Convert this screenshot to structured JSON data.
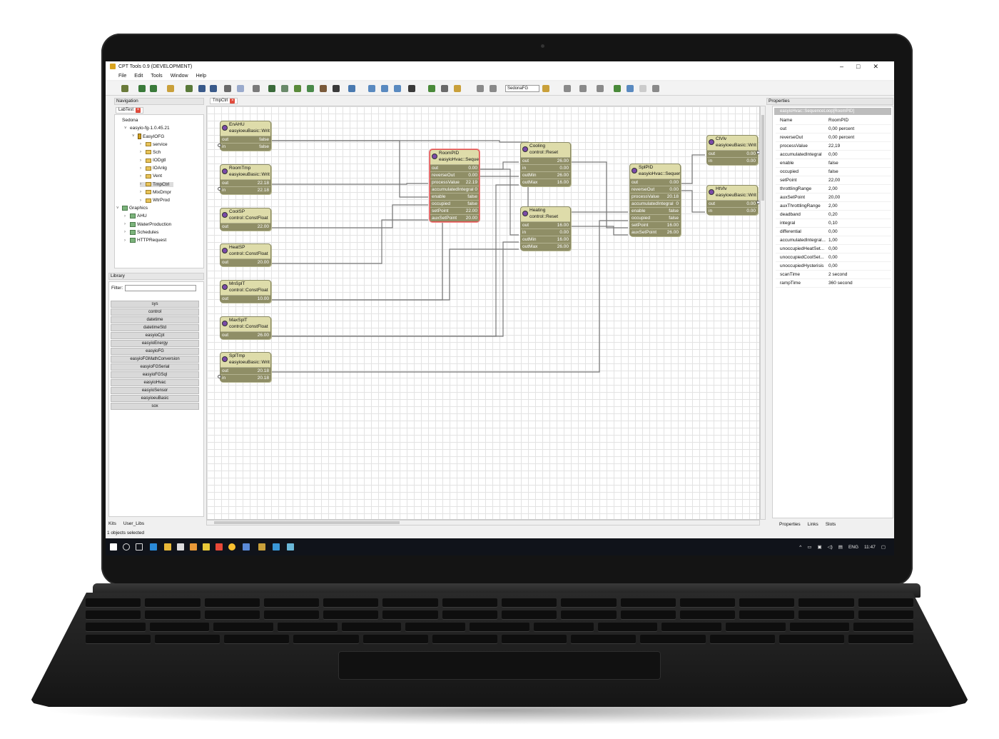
{
  "window": {
    "title": "CPT Tools 0.9 (DEVELOPMENT)",
    "controls": [
      "–",
      "□",
      "✕"
    ]
  },
  "menu": [
    "File",
    "Edit",
    "Tools",
    "Window",
    "Help"
  ],
  "toolbar": {
    "platform_select": "SedonaFG"
  },
  "navigation": {
    "title": "Navigation",
    "tab": "LabTest",
    "tree": [
      {
        "label": "Sedona",
        "depth": 0,
        "icon": "none",
        "arrow": ""
      },
      {
        "label": "easyio-fg-1.0.45.21",
        "depth": 1,
        "icon": "none",
        "arrow": "˅"
      },
      {
        "label": "EasyIOFG",
        "depth": 2,
        "icon": "device",
        "arrow": "˅"
      },
      {
        "label": "service",
        "depth": 3,
        "icon": "folder",
        "arrow": "›"
      },
      {
        "label": "Sch",
        "depth": 3,
        "icon": "folder",
        "arrow": "›"
      },
      {
        "label": "IODgtl",
        "depth": 3,
        "icon": "folder",
        "arrow": "›"
      },
      {
        "label": "IOAnlg",
        "depth": 3,
        "icon": "folder",
        "arrow": "›"
      },
      {
        "label": "Vent",
        "depth": 3,
        "icon": "folder",
        "arrow": "›"
      },
      {
        "label": "TmpCtrl",
        "depth": 3,
        "icon": "folder",
        "arrow": "›",
        "selected": true
      },
      {
        "label": "MixDmpr",
        "depth": 3,
        "icon": "folder",
        "arrow": "›"
      },
      {
        "label": "WtrProd",
        "depth": 3,
        "icon": "folder",
        "arrow": "›"
      },
      {
        "label": "Graphics",
        "depth": 0,
        "icon": "graphics",
        "arrow": "˅"
      },
      {
        "label": "AHU",
        "depth": 1,
        "icon": "graphics",
        "arrow": "›"
      },
      {
        "label": "WaterProduction",
        "depth": 1,
        "icon": "graphics",
        "arrow": "›"
      },
      {
        "label": "Schedules",
        "depth": 1,
        "icon": "graphics",
        "arrow": "›"
      },
      {
        "label": "HTTPRequest",
        "depth": 1,
        "icon": "graphics",
        "arrow": "›"
      }
    ]
  },
  "library": {
    "title": "Library",
    "filter_label": "Filter:",
    "items": [
      "sys",
      "control",
      "datetime",
      "datetimeStd",
      "easyioCpt",
      "easyioEnergy",
      "easyioFG",
      "easyioFGMathConversion",
      "easyioFGSerial",
      "easyioFGSql",
      "easyioHvac",
      "easyioSensor",
      "easyioeuBasic",
      "sox"
    ],
    "bottom_tabs": [
      "Kits",
      "User_Libs"
    ]
  },
  "wiresheet": {
    "tab": "TmpCtrl",
    "blocks": [
      {
        "id": "enahu",
        "name": "EnAHU",
        "type": "easyioeuBasic::Writ",
        "slots": [
          [
            "out",
            "false"
          ],
          [
            "in",
            "false"
          ]
        ]
      },
      {
        "id": "roomtmp",
        "name": "RoomTmp",
        "type": "easyioeuBasic::Writ",
        "slots": [
          [
            "out",
            "22.18"
          ],
          [
            "in",
            "22.18"
          ]
        ]
      },
      {
        "id": "coolsp",
        "name": "CoolSP",
        "type": "control::ConstFloat",
        "slots": [
          [
            "out",
            "22.00"
          ]
        ]
      },
      {
        "id": "heatsp",
        "name": "HeatSP",
        "type": "control::ConstFloat",
        "slots": [
          [
            "out",
            "20.00"
          ]
        ]
      },
      {
        "id": "mnsplt",
        "name": "MnSplT",
        "type": "control::ConstFloat",
        "slots": [
          [
            "out",
            "10.00"
          ]
        ]
      },
      {
        "id": "maxsplt",
        "name": "MaxSplT",
        "type": "control::ConstFloat",
        "slots": [
          [
            "out",
            "26.00"
          ]
        ]
      },
      {
        "id": "spltmp",
        "name": "SplTmp",
        "type": "easyioeuBasic::Writ",
        "slots": [
          [
            "out",
            "20.18"
          ],
          [
            "in",
            "20.18"
          ]
        ]
      },
      {
        "id": "roompid",
        "name": "RoomPID",
        "type": "easyioHvac::Sequer",
        "selected": true,
        "slots": [
          [
            "out",
            "0.00"
          ],
          [
            "reverseOut",
            "0.00"
          ],
          [
            "processValue",
            "22.19"
          ],
          [
            "accumulatedIntegral",
            "0"
          ],
          [
            "enable",
            "false"
          ],
          [
            "occupied",
            "false"
          ],
          [
            "setPoint",
            "22.00"
          ],
          [
            "auxSetPoint",
            "20.00"
          ]
        ]
      },
      {
        "id": "cooling",
        "name": "Cooling",
        "type": "control::Reset",
        "slots": [
          [
            "out",
            "26.00"
          ],
          [
            "in",
            "0.00"
          ],
          [
            "outMin",
            "26.00"
          ],
          [
            "outMax",
            "16.00"
          ]
        ]
      },
      {
        "id": "heating",
        "name": "Heating",
        "type": "control::Reset",
        "slots": [
          [
            "out",
            "16.00"
          ],
          [
            "in",
            "0.00"
          ],
          [
            "outMin",
            "16.00"
          ],
          [
            "outMax",
            "26.00"
          ]
        ]
      },
      {
        "id": "splpid",
        "name": "SplPID",
        "type": "easyioHvac::Sequer",
        "slots": [
          [
            "out",
            "0.00"
          ],
          [
            "reverseOut",
            "0.00"
          ],
          [
            "processValue",
            "20.18"
          ],
          [
            "accumulatedIntegral",
            "0"
          ],
          [
            "enable",
            "false"
          ],
          [
            "occupied",
            "false"
          ],
          [
            "setPoint",
            "16.00"
          ],
          [
            "auxSetPoint",
            "26.00"
          ]
        ]
      },
      {
        "id": "clvlv",
        "name": "ClVlv",
        "type": "easyioeuBasic::Writ",
        "slots": [
          [
            "out",
            "0.00"
          ],
          [
            "in",
            "0.00"
          ]
        ]
      },
      {
        "id": "htvlv",
        "name": "HtVlv",
        "type": "easyioeuBasic::Writ",
        "slots": [
          [
            "out",
            "0.00"
          ],
          [
            "in",
            "0.00"
          ]
        ]
      }
    ]
  },
  "properties": {
    "title": "Properties",
    "object": "easyioHvac::SequenceLoop[RoomPID]",
    "rows": [
      [
        "Name",
        "RoomPID"
      ],
      [
        "out",
        "0,00 percent"
      ],
      [
        "reverseOut",
        "0,00 percent"
      ],
      [
        "processValue",
        "22,19"
      ],
      [
        "accumulatedIntegral",
        "0,00"
      ],
      [
        "enable",
        "false"
      ],
      [
        "occupied",
        "false"
      ],
      [
        "setPoint",
        "22,00"
      ],
      [
        "throttlingRange",
        "2,00"
      ],
      [
        "auxSetPoint",
        "20,00"
      ],
      [
        "auxThrottlingRange",
        "2,00"
      ],
      [
        "deadband",
        "0,20"
      ],
      [
        "integral",
        "0,10"
      ],
      [
        "differential",
        "0,00"
      ],
      [
        "accumulatedIntegral...",
        "1,00"
      ],
      [
        "unoccupiedHeatSet...",
        "0,00"
      ],
      [
        "unoccupiedCoolSet...",
        "0,00"
      ],
      [
        "unoccupiedHysterisis",
        "0,00"
      ],
      [
        "scanTime",
        "2 second"
      ],
      [
        "rampTime",
        "360 second"
      ]
    ],
    "bottom_tabs": [
      "Properties",
      "Links",
      "Slots"
    ]
  },
  "status": {
    "text": "1 objects selected"
  },
  "taskbar": {
    "language": "ENG",
    "time": "11:47"
  },
  "colors": {
    "block_body": "#dedcaa",
    "slot_bar": "#8f8e66",
    "selected_border": "#e05050",
    "taskbar": "#10131a"
  }
}
